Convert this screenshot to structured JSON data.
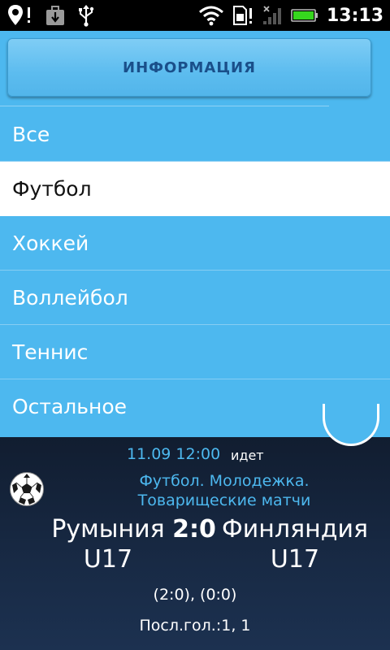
{
  "status_bar": {
    "time": "13:13",
    "icons": [
      "location-alert-icon",
      "download-icon",
      "usb-icon",
      "wifi-icon",
      "sim-alert-icon",
      "signal-icon",
      "battery-icon"
    ]
  },
  "header": {
    "button_label": "ИНФОРМАЦИЯ"
  },
  "menu": {
    "selected_index": 1,
    "items": [
      {
        "label": "Все"
      },
      {
        "label": "Футбол"
      },
      {
        "label": "Хоккей"
      },
      {
        "label": "Воллейбол"
      },
      {
        "label": "Теннис"
      },
      {
        "label": "Остальное"
      }
    ]
  },
  "match": {
    "datetime": "11.09 12:00",
    "status": "идет",
    "sport_icon": "soccer-ball-icon",
    "league": "Футбол. Молодежка. Товарищеские матчи",
    "home_team": "Румыния U17",
    "away_team": "Финляндия U17",
    "score": "2:0",
    "half_scores": "(2:0), (0:0)",
    "last_goal": "Посл.гол.:1, 1"
  },
  "colors": {
    "accent": "#4db8ef",
    "button_text": "#1a4f8a",
    "card_background": "#182a45"
  }
}
